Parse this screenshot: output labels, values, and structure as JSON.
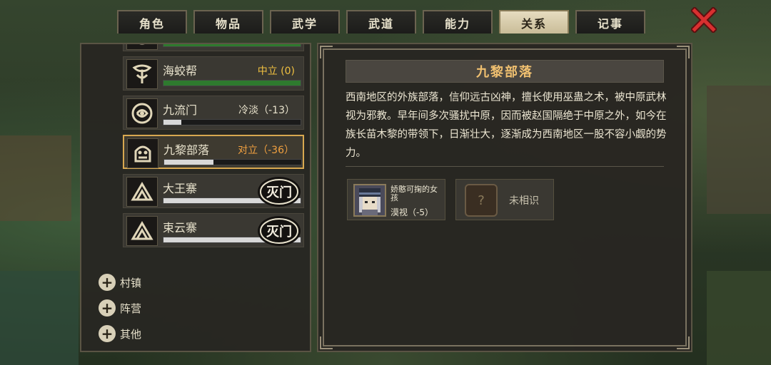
{
  "tabs": [
    {
      "label": "角色",
      "active": false
    },
    {
      "label": "物品",
      "active": false
    },
    {
      "label": "武学",
      "active": false
    },
    {
      "label": "武道",
      "active": false
    },
    {
      "label": "能力",
      "active": false
    },
    {
      "label": "关系",
      "active": true
    },
    {
      "label": "记事",
      "active": false
    }
  ],
  "close_icon": "close-x-icon",
  "factions": [
    {
      "name": "",
      "status": "",
      "status_color": "#f0c040",
      "bar_color": "#2e7a2e",
      "bar_fill": 1.0,
      "sealed": false,
      "emblem": "crest-icon"
    },
    {
      "name": "海蛟帮",
      "status": "中立 (0)",
      "status_color": "#f0c040",
      "bar_color": "#2e7a2e",
      "bar_fill": 1.0,
      "sealed": false,
      "emblem": "sea-dragon-crest-icon"
    },
    {
      "name": "九流门",
      "status": "冷淡（-13）",
      "status_color": "#e8e2cc",
      "bar_color": "#d8d8d8",
      "bar_fill": 0.13,
      "sealed": false,
      "emblem": "nine-streams-crest-icon"
    },
    {
      "name": "九黎部落",
      "status": "对立（-36）",
      "status_color": "#f0a040",
      "bar_color": "#d8d8d8",
      "bar_fill": 0.36,
      "sealed": false,
      "emblem": "jiuli-tribe-crest-icon"
    },
    {
      "name": "大王寨",
      "status": "",
      "status_color": "#e8e2cc",
      "bar_color": "#d8d8d8",
      "bar_fill": 1.0,
      "sealed": true,
      "emblem": "mountain-fort-crest-icon"
    },
    {
      "name": "束云寨",
      "status": "",
      "status_color": "#e8e2cc",
      "bar_color": "#d8d8d8",
      "bar_fill": 1.0,
      "sealed": true,
      "emblem": "mountain-fort-crest-icon"
    }
  ],
  "sealed_stamp_text": "灭门",
  "categories": [
    {
      "label": "村镇"
    },
    {
      "label": "阵营"
    },
    {
      "label": "其他"
    }
  ],
  "detail": {
    "title": "九黎部落",
    "description": "西南地区的外族部落，信仰远古凶神，擅长使用巫蛊之术，被中原武林视为邪教。早年间多次骚扰中原，因而被赵国隔绝于中原之外，如今在族长苗木黎的带领下，日渐壮大，逐渐成为西南地区一股不容小觑的势力。",
    "npcs": [
      {
        "name": "娇憨可掬的女孩",
        "status": "漠视（-5）"
      }
    ],
    "unknown": {
      "icon": "question-mark-icon",
      "label": "未相识"
    }
  }
}
